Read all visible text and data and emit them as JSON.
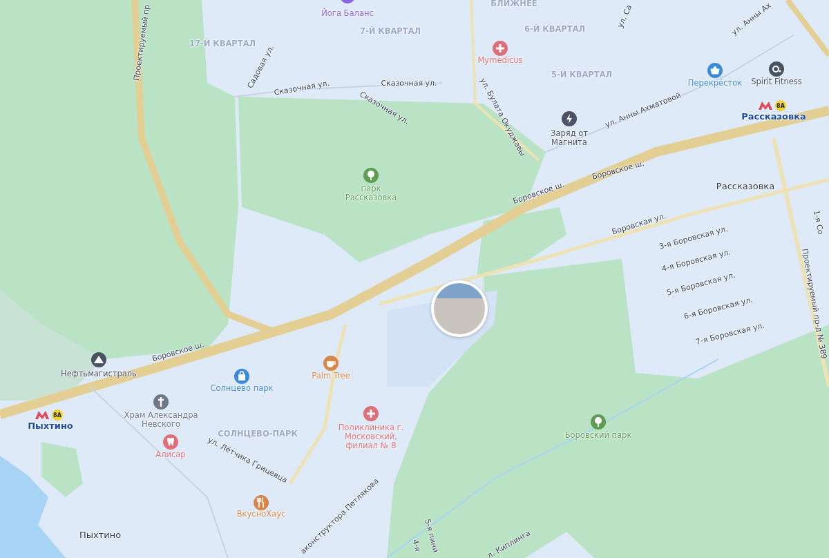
{
  "map": {
    "districts": [
      {
        "text": "БЛИЖНЕЕ"
      },
      {
        "text": "7-Й КВАРТАЛ"
      },
      {
        "text": "6-Й КВАРТАЛ"
      },
      {
        "text": "17-Й КВАРТАЛ"
      },
      {
        "text": "5-Й КВАРТАЛ"
      },
      {
        "text": "СОЛНЦЕВО-ПАРК"
      }
    ],
    "streets": [
      {
        "text": "Проектируемый пр"
      },
      {
        "text": "ул. Са"
      },
      {
        "text": "ул. Анны Ах"
      },
      {
        "text": "Садовая ул."
      },
      {
        "text": "Сказочная ул."
      },
      {
        "text": "Сказочная ул."
      },
      {
        "text": "Сказочная ул."
      },
      {
        "text": "ул. Булата Окуджавы"
      },
      {
        "text": "ул. Анны Ахматовой"
      },
      {
        "text": "Боровское ш."
      },
      {
        "text": "Боровское ш."
      },
      {
        "text": "Боровская ул."
      },
      {
        "text": "1-я Со"
      },
      {
        "text": "3-я Боровская ул."
      },
      {
        "text": "4-я Боровская ул."
      },
      {
        "text": "5-я Боровская ул."
      },
      {
        "text": "6-я Боровская ул."
      },
      {
        "text": "7-я Боровская ул."
      },
      {
        "text": "Проектируемый пр-д № 389"
      },
      {
        "text": "Боровское ш."
      },
      {
        "text": "ул. Лётчика Грицевца"
      },
      {
        "text": "аконструктора Петлякова"
      },
      {
        "text": "5-я лини"
      },
      {
        "text": "4-я"
      },
      {
        "text": "л. Киплинга"
      }
    ],
    "places": [
      {
        "text": "Рассказовка"
      },
      {
        "text": "Пыхтино"
      }
    ],
    "pois": [
      {
        "text": "Йога Баланс",
        "color": "#8a63e6"
      },
      {
        "text": "Mymedicus",
        "color": "#de6f78"
      },
      {
        "text": "Перекрёсток",
        "color": "#3a8be0"
      },
      {
        "text": "Spirit Fitness",
        "color": "#4a5264"
      },
      {
        "text": "Заряд от\nМагнита",
        "color": "#4a5264"
      },
      {
        "text": "парк\nРассказовка",
        "color": "#5e9c54"
      },
      {
        "text": "Нефтьмагистраль",
        "color": "#4a5264"
      },
      {
        "text": "Солнцево парк",
        "color": "#3a8be0"
      },
      {
        "text": "Palm Tree",
        "color": "#d8874a"
      },
      {
        "text": "Храм Александра\nНевского",
        "color": "#6f7684"
      },
      {
        "text": "Алисар",
        "color": "#de6f78"
      },
      {
        "text": "Поликлиника г.\nМосковский,\nфилиал № 8",
        "color": "#de6f78"
      },
      {
        "text": "ВкусноХаус",
        "color": "#d8874a"
      },
      {
        "text": "Боровский парк",
        "color": "#5e9c54"
      }
    ],
    "metro_stations": [
      {
        "text": "Рассказовка",
        "line": "8А"
      },
      {
        "text": "Пыхтино",
        "line": "8А"
      }
    ]
  }
}
